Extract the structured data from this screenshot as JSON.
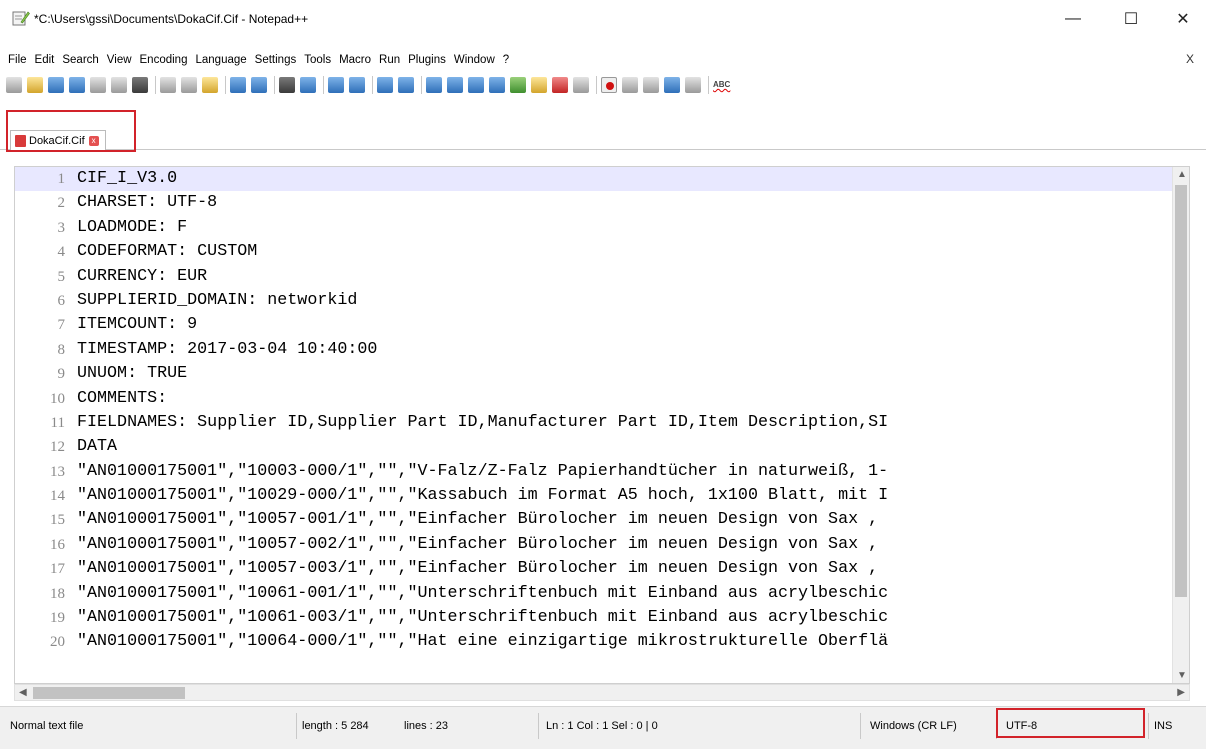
{
  "window": {
    "title": "*C:\\Users\\gssi\\Documents\\DokaCif.Cif - Notepad++",
    "minimize": "—",
    "maximize": "☐",
    "close": "✕"
  },
  "menu": {
    "items": [
      "File",
      "Edit",
      "Search",
      "View",
      "Encoding",
      "Language",
      "Settings",
      "Tools",
      "Macro",
      "Run",
      "Plugins",
      "Window",
      "?"
    ],
    "close_doc": "X"
  },
  "tab": {
    "label": "DokaCif.Cif",
    "close": "x"
  },
  "editor": {
    "lines": [
      {
        "n": "1",
        "text": "CIF_I_V3.0"
      },
      {
        "n": "2",
        "text": "CHARSET: UTF-8"
      },
      {
        "n": "3",
        "text": "LOADMODE: F"
      },
      {
        "n": "4",
        "text": "CODEFORMAT: CUSTOM"
      },
      {
        "n": "5",
        "text": "CURRENCY: EUR"
      },
      {
        "n": "6",
        "text": "SUPPLIERID_DOMAIN: networkid"
      },
      {
        "n": "7",
        "text": "ITEMCOUNT: 9"
      },
      {
        "n": "8",
        "text": "TIMESTAMP: 2017-03-04  10:40:00"
      },
      {
        "n": "9",
        "text": "UNUOM: TRUE"
      },
      {
        "n": "10",
        "text": "COMMENTS:"
      },
      {
        "n": "11",
        "text": "FIELDNAMES: Supplier ID,Supplier Part ID,Manufacturer Part ID,Item Description,SI"
      },
      {
        "n": "12",
        "text": "DATA"
      },
      {
        "n": "13",
        "text": "\"AN01000175001\",\"10003-000/1\",\"\",\"V-Falz/Z-Falz Papierhandtücher in naturweiß, 1-"
      },
      {
        "n": "14",
        "text": "\"AN01000175001\",\"10029-000/1\",\"\",\"Kassabuch im Format A5 hoch, 1x100 Blatt, mit I"
      },
      {
        "n": "15",
        "text": "\"AN01000175001\",\"10057-001/1\",\"\",\"Einfacher Bürolocher im neuen Design von Sax ,"
      },
      {
        "n": "16",
        "text": "\"AN01000175001\",\"10057-002/1\",\"\",\"Einfacher Bürolocher im neuen Design von Sax ,"
      },
      {
        "n": "17",
        "text": "\"AN01000175001\",\"10057-003/1\",\"\",\"Einfacher Bürolocher im neuen Design von Sax ,"
      },
      {
        "n": "18",
        "text": "\"AN01000175001\",\"10061-001/1\",\"\",\"Unterschriftenbuch mit Einband aus acrylbeschic"
      },
      {
        "n": "19",
        "text": "\"AN01000175001\",\"10061-003/1\",\"\",\"Unterschriftenbuch mit Einband aus acrylbeschic"
      },
      {
        "n": "20",
        "text": "\"AN01000175001\",\"10064-000/1\",\"\",\"Hat eine einzigartige mikrostrukturelle Oberflä"
      }
    ]
  },
  "status": {
    "file_type": "Normal text file",
    "length": "length : 5 284",
    "lines": "lines : 23",
    "position": "Ln : 1   Col : 1   Sel : 0 | 0",
    "eol": "Windows (CR LF)",
    "encoding": "UTF-8",
    "mode": "INS"
  },
  "colors": {
    "highlight_box": "#d2232a",
    "current_line": "#e8e8ff",
    "line_number": "#8a8a8a"
  }
}
